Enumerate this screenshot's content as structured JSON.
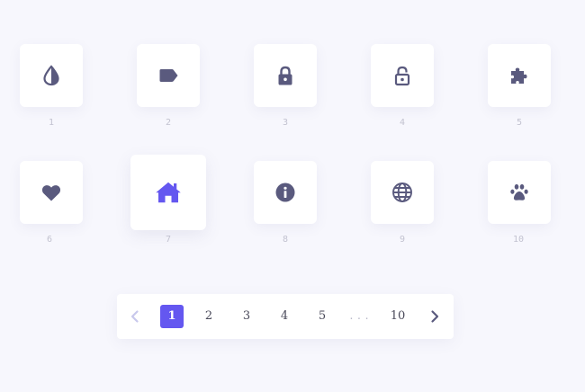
{
  "colors": {
    "icon": "#5a5a7e",
    "accent": "#6457f0",
    "disabled": "#c8c8ec",
    "caption": "#c2c2d0"
  },
  "icons": [
    {
      "name": "tint-icon",
      "number": "1"
    },
    {
      "name": "tag-icon",
      "number": "2"
    },
    {
      "name": "lock-icon",
      "number": "3"
    },
    {
      "name": "unlock-icon",
      "number": "4"
    },
    {
      "name": "puzzle-icon",
      "number": "5"
    },
    {
      "name": "heart-icon",
      "number": "6"
    },
    {
      "name": "home-icon",
      "number": "7",
      "active": true
    },
    {
      "name": "info-icon",
      "number": "8"
    },
    {
      "name": "globe-icon",
      "number": "9"
    },
    {
      "name": "paw-icon",
      "number": "10"
    }
  ],
  "pagination": {
    "prev_icon": "chevron-left-icon",
    "next_icon": "chevron-right-icon",
    "pages": [
      "1",
      "2",
      "3",
      "4",
      "5"
    ],
    "current": "1",
    "ellipsis": "...",
    "last": "10"
  }
}
